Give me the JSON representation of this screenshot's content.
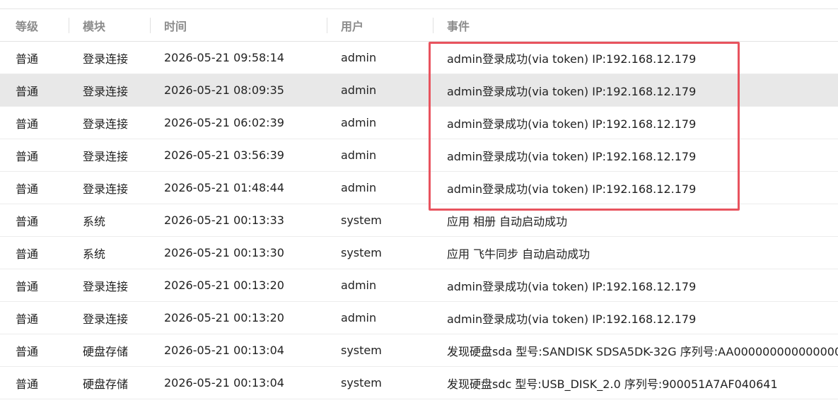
{
  "headers": {
    "level": "等级",
    "module": "模块",
    "time": "时间",
    "user": "用户",
    "event": "事件"
  },
  "rows": [
    {
      "level": "普通",
      "module": "登录连接",
      "time": "2026-05-21 09:58:14",
      "user": "admin",
      "event": "admin登录成功(via token) IP:192.168.12.179"
    },
    {
      "level": "普通",
      "module": "登录连接",
      "time": "2026-05-21 08:09:35",
      "user": "admin",
      "event": "admin登录成功(via token) IP:192.168.12.179"
    },
    {
      "level": "普通",
      "module": "登录连接",
      "time": "2026-05-21 06:02:39",
      "user": "admin",
      "event": "admin登录成功(via token) IP:192.168.12.179"
    },
    {
      "level": "普通",
      "module": "登录连接",
      "time": "2026-05-21 03:56:39",
      "user": "admin",
      "event": "admin登录成功(via token) IP:192.168.12.179"
    },
    {
      "level": "普通",
      "module": "登录连接",
      "time": "2026-05-21 01:48:44",
      "user": "admin",
      "event": "admin登录成功(via token) IP:192.168.12.179"
    },
    {
      "level": "普通",
      "module": "系统",
      "time": "2026-05-21 00:13:33",
      "user": "system",
      "event": "应用 相册 自动启动成功"
    },
    {
      "level": "普通",
      "module": "系统",
      "time": "2026-05-21 00:13:30",
      "user": "system",
      "event": "应用 飞牛同步 自动启动成功"
    },
    {
      "level": "普通",
      "module": "登录连接",
      "time": "2026-05-21 00:13:20",
      "user": "admin",
      "event": "admin登录成功(via token) IP:192.168.12.179"
    },
    {
      "level": "普通",
      "module": "登录连接",
      "time": "2026-05-21 00:13:20",
      "user": "admin",
      "event": "admin登录成功(via token) IP:192.168.12.179"
    },
    {
      "level": "普通",
      "module": "硬盘存储",
      "time": "2026-05-21 00:13:04",
      "user": "system",
      "event": "发现硬盘sda 型号:SANDISK SDSA5DK-32G 序列号:AA000000000000000"
    },
    {
      "level": "普通",
      "module": "硬盘存储",
      "time": "2026-05-21 00:13:04",
      "user": "system",
      "event": "发现硬盘sdc 型号:USB_DISK_2.0 序列号:900051A7AF040641"
    }
  ],
  "colors": {
    "highlight_row": "#e8e8e8",
    "annotation_box": "#e8535e",
    "header_text": "#8c8c8c",
    "body_text": "#222222"
  }
}
